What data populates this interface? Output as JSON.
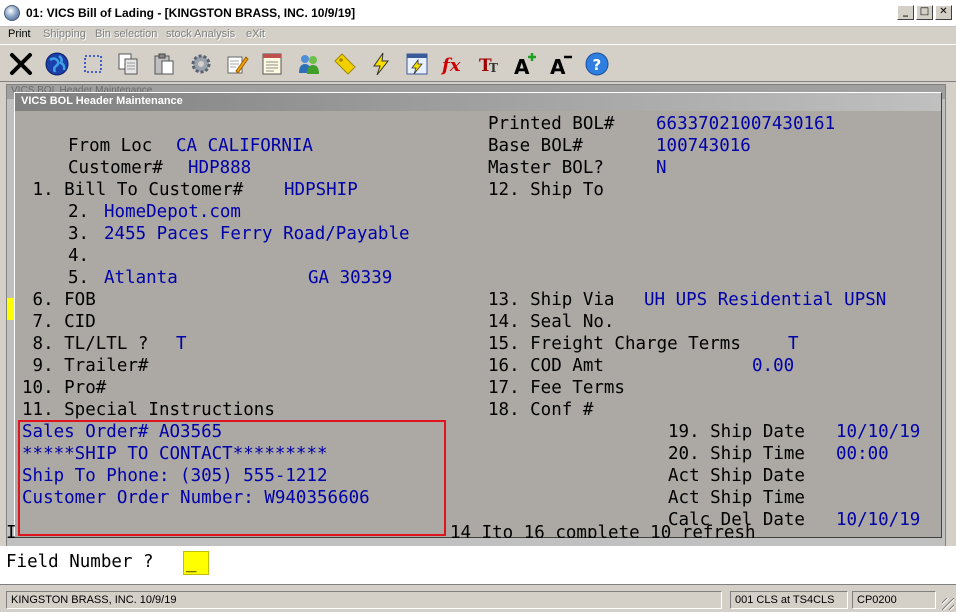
{
  "window": {
    "title": "01: VICS Bill of Lading - [KINGSTON BRASS, INC. 10/9/19]",
    "controls": [
      "_",
      "□",
      "✕"
    ]
  },
  "menu": [
    {
      "label": "Print",
      "enabled": true
    },
    {
      "label": "Shipping",
      "enabled": false
    },
    {
      "label": "Bin selection",
      "enabled": false
    },
    {
      "label": "stock Analysis",
      "enabled": false
    },
    {
      "label": "eXit",
      "enabled": false
    }
  ],
  "toolbar_icons": [
    "exit-x-icon",
    "globe-icon",
    "select-icon",
    "copy-icon",
    "paste-icon",
    "gear-icon",
    "edit-icon",
    "notes-icon",
    "users-icon",
    "tag-icon",
    "lightning-icon",
    "calc-icon",
    "function-icon",
    "font-icon",
    "font-bigger-icon",
    "font-smaller-icon",
    "help-icon"
  ],
  "background_window": {
    "title": "VICS BOL Header Maintenance"
  },
  "dialog": {
    "title": "VICS BOL Header Maintenance",
    "left": {
      "from_loc_label": "From Loc",
      "from_loc_value": "CA CALIFORNIA",
      "customer_label": "Customer#",
      "customer_value": "HDP888",
      "f1_label": " 1. Bill To Customer#",
      "f1_value": "HDPSHIP",
      "f2_label": "2.",
      "f2_value": "HomeDepot.com",
      "f3_label": "3.",
      "f3_value": "2455 Paces Ferry Road/Payable",
      "f4_label": "4.",
      "f5_label": "5.",
      "f5_city": "Atlanta",
      "f5_state_zip": "GA 30339",
      "f6_label": " 6. FOB",
      "f7_label": " 7. CID",
      "f8_label": " 8. TL/LTL ?",
      "f8_value": "T",
      "f9_label": " 9. Trailer#",
      "f10_label": "10. Pro#",
      "f11_label": "11. Special Instructions"
    },
    "right": {
      "printed_bol_label": "Printed BOL#",
      "printed_bol_value": "66337021007430161",
      "base_bol_label": "Base BOL#",
      "base_bol_value": "100743016",
      "master_bol_label": "Master BOL?",
      "master_bol_value": "N",
      "f12_label": "12. Ship To",
      "f13_label": "13. Ship Via",
      "f13_value": "UH UPS Residential UPSN",
      "f14_label": "14. Seal No.",
      "f15_label": "15. Freight Charge Terms",
      "f15_value": "T",
      "f16_label": "16. COD Amt",
      "f16_value": "0.00",
      "f17_label": "17. Fee Terms",
      "f18_label": "18. Conf #",
      "f19_label": "19. Ship Date",
      "f19_value": "10/10/19",
      "f20_label": "20. Ship Time",
      "f20_value": "00:00",
      "act_ship_date_label": "Act Ship Date",
      "act_ship_time_label": "Act Ship Time",
      "calc_del_date_label": "Calc Del Date",
      "calc_del_date_value": "10/10/19"
    },
    "special_instructions": [
      "Sales Order# AO3565",
      "*****SHIP TO CONTACT*********",
      "Ship To Phone: (305) 555-1212",
      "Customer Order Number: W940356606"
    ]
  },
  "remnant_line": "I",
  "remnant_right": "14 Ito 16 complete 10 refresh",
  "prompt": {
    "label": "Field Number ?",
    "value": "_"
  },
  "status": {
    "company": "KINGSTON BRASS, INC. 10/9/19",
    "session": "001 CLS at TS4CLS",
    "program": "CP0200"
  }
}
